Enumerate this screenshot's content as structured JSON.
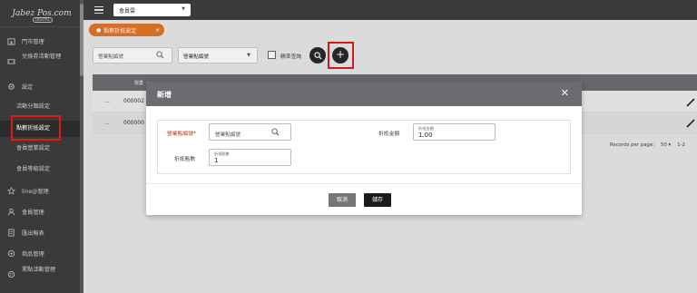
{
  "brand": {
    "logo_text": "Jabez Pos.com",
    "badge": "DIGITAL"
  },
  "topbar": {
    "store_select": "會員雲"
  },
  "sidebar": {
    "items": [
      {
        "label": "門市管理",
        "icon": "store-icon"
      },
      {
        "label": "兌換券活動管理",
        "icon": "ticket-icon"
      },
      {
        "label": "設定",
        "icon": "settings-icon"
      },
      {
        "label": "活動分類設定",
        "icon": ""
      },
      {
        "label": "點數折抵設定",
        "icon": ""
      },
      {
        "label": "會員營業設定",
        "icon": ""
      },
      {
        "label": "會員等級設定",
        "icon": ""
      },
      {
        "label": "line@管理",
        "icon": "star-icon"
      },
      {
        "label": "會員管理",
        "icon": "user-icon"
      },
      {
        "label": "匯出報表",
        "icon": "report-icon"
      },
      {
        "label": "商品管理",
        "icon": "product-icon"
      },
      {
        "label": "累點活動管理",
        "icon": "points-icon"
      }
    ],
    "active_index": 4
  },
  "tab": {
    "label": "點數折抵設定",
    "close": "×"
  },
  "filters": {
    "search_placeholder": "營業點編號",
    "select_value": "營業點編號",
    "exact_label": "精準查詢"
  },
  "table": {
    "header_partial": "營業",
    "rows": [
      {
        "dash": "—",
        "id": "000002"
      },
      {
        "dash": "—",
        "id": "000000"
      }
    ],
    "pager": {
      "records_label": "Records per page:",
      "per_page": "50",
      "range": "1-2"
    }
  },
  "modal": {
    "title": "新增",
    "close": "✕",
    "fields": {
      "store_label": "營業點編號*",
      "store_placeholder": "營業點編號",
      "amount_label": "折抵金額",
      "amount_mini": "折抵金額",
      "amount_value": "1.00",
      "points_label": "折抵點數",
      "points_mini": "折抵點數",
      "points_value": "1"
    },
    "cancel": "取消",
    "save": "儲存"
  },
  "colors": {
    "sidebar_bg": "#3a3a3a",
    "accent_orange": "#e0782a",
    "highlight_red": "#e01a1a",
    "modal_header": "#6c6c70"
  }
}
